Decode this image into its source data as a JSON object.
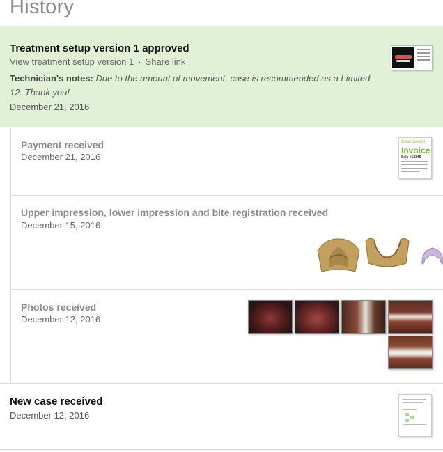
{
  "page": {
    "title": "History"
  },
  "approved": {
    "heading": "Treatment setup version 1 approved",
    "view_link": "View treatment setup version 1",
    "separator": "·",
    "share_link": "Share link",
    "notes_label": "Technician's notes:",
    "notes_text": "Due to the amount of movement, case is recommended as a Limited 12. Thank you!",
    "date": "December 21, 2016"
  },
  "events": [
    {
      "heading": "Payment received",
      "date": "December 21, 2016"
    },
    {
      "heading": "Upper impression, lower impression and bite registration received",
      "date": "December 15, 2016"
    },
    {
      "heading": "Photos received",
      "date": "December 12, 2016"
    }
  ],
  "invoice_thumb": {
    "brand": "ClearCorrect",
    "title": "Invoice",
    "sale": "Sale #12345"
  },
  "new_case": {
    "heading": "New case received",
    "date": "December 12, 2016"
  },
  "colors": {
    "approved_bg": "#e1f1d8",
    "invoice_green": "#7cb342",
    "muted_heading": "#8a8a8a"
  }
}
